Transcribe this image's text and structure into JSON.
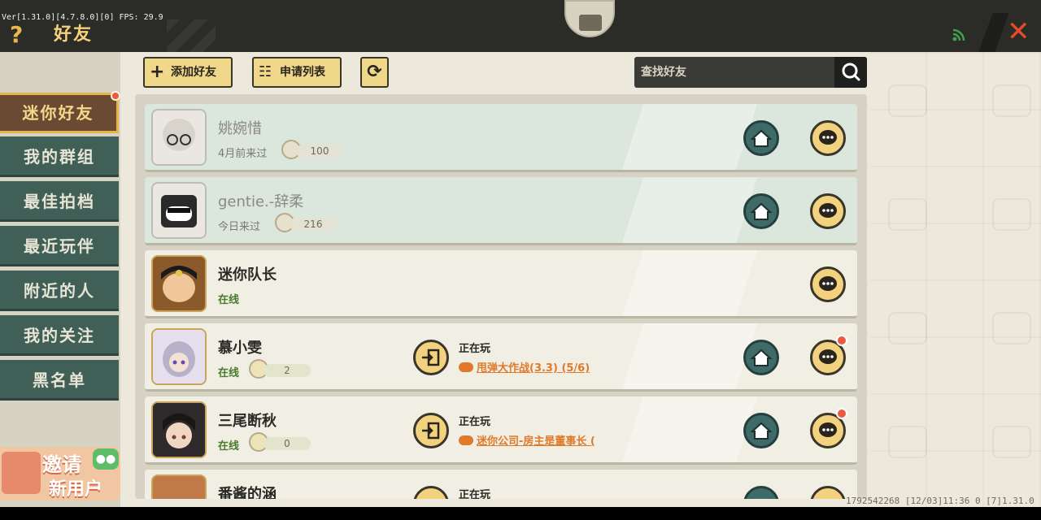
{
  "debug": {
    "version_text": "Ver[1.31.0][4.7.8.0][0] FPS: 29.9"
  },
  "header": {
    "title": "好友",
    "help_icon": "question-mark-icon",
    "close_icon": "close-x-icon"
  },
  "sidebar": {
    "items": [
      {
        "label": "迷你好友",
        "active": true,
        "notify": true
      },
      {
        "label": "我的群组"
      },
      {
        "label": "最佳拍档"
      },
      {
        "label": "最近玩伴"
      },
      {
        "label": "附近的人"
      },
      {
        "label": "我的关注"
      },
      {
        "label": "黑名单"
      }
    ],
    "invite": {
      "line1": "邀请",
      "line2": "新用户"
    }
  },
  "toolbar": {
    "add_friend": "添加好友",
    "request_list": "申请列表",
    "search_placeholder": "查找好友"
  },
  "friends": [
    {
      "name": "姚婉惜",
      "status": "4月前来过",
      "level": "100",
      "online": false,
      "has_home": true,
      "unread": false
    },
    {
      "name": "gentie.-辞柔",
      "status": "今日来过",
      "level": "216",
      "online": false,
      "has_home": true,
      "unread": false
    },
    {
      "name": "迷你队长",
      "status": "在线",
      "online": true,
      "has_home": false,
      "unread": false
    },
    {
      "name": "慕小雯",
      "status": "在线",
      "level": "2",
      "online": true,
      "has_home": true,
      "unread": true,
      "playing_label": "正在玩",
      "game": "甩弹大作战(3.3) (5/6)"
    },
    {
      "name": "三尾断秋",
      "status": "在线",
      "level": "0",
      "online": true,
      "has_home": true,
      "unread": true,
      "playing_label": "正在玩",
      "game": "迷你公司-房主是董事长 ("
    },
    {
      "name": "番酱的涵",
      "status": "",
      "online": true,
      "partial": true,
      "playing_label": "正在玩"
    }
  ],
  "footer": {
    "text": "1792542268   [12/03]11:36 0  [7]1.31.0"
  },
  "colors": {
    "accent": "#efd889",
    "sidebar": "#3f5f57",
    "active": "#6a4a32",
    "link": "#e07a2a"
  }
}
